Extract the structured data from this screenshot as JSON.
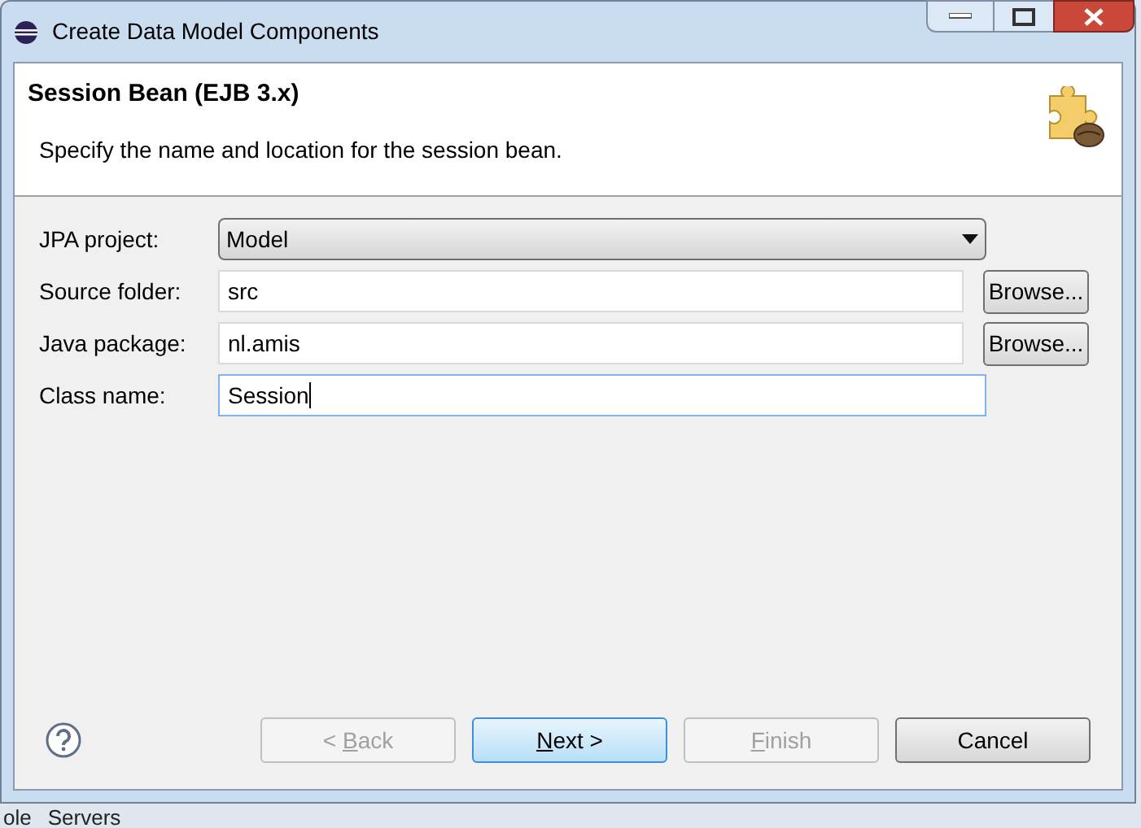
{
  "window": {
    "title": "Create Data Model Components"
  },
  "header": {
    "title": "Session Bean (EJB 3.x)",
    "description": "Specify the name and location for the session bean."
  },
  "fields": [
    {
      "kind": "dropdown",
      "label": "JPA project:",
      "value": "Model"
    },
    {
      "kind": "browse",
      "label": "Source folder:",
      "value": "src",
      "button": "Browse..."
    },
    {
      "kind": "browse",
      "label": "Java package:",
      "value": "nl.amis",
      "button": "Browse..."
    },
    {
      "kind": "text",
      "label": "Class name:",
      "value": "Session",
      "focused": true
    }
  ],
  "buttons": [
    {
      "before": "< ",
      "mnemonic": "B",
      "after": "ack",
      "disabled": true,
      "default": false
    },
    {
      "mnemonic": "N",
      "after": "ext >",
      "disabled": false,
      "default": true
    },
    {
      "mnemonic": "F",
      "after": "inish",
      "disabled": true,
      "default": false
    },
    {
      "before": "Cancel",
      "disabled": false,
      "default": false
    }
  ],
  "background_tabs": [
    "ole",
    "Servers"
  ]
}
